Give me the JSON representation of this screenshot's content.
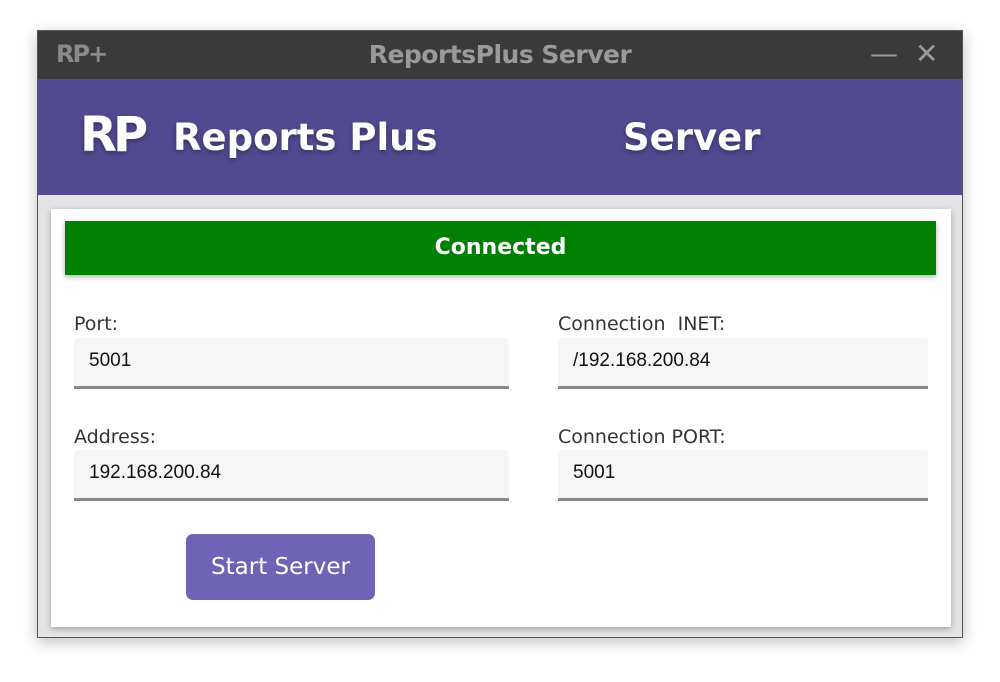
{
  "titlebar": {
    "logo": "RP+",
    "title": "ReportsPlus Server",
    "minimize": "—",
    "close": "✕"
  },
  "header": {
    "logo": "RP",
    "name": "Reports Plus",
    "subtitle": "Server"
  },
  "status": {
    "text": "Connected",
    "color": "#008000"
  },
  "fields": {
    "port": {
      "label": "Port:",
      "value": "5001"
    },
    "address": {
      "label": "Address:",
      "value": "192.168.200.84"
    },
    "conn_inet": {
      "label": "Connection  INET:",
      "value": "/192.168.200.84"
    },
    "conn_port": {
      "label": "Connection PORT:",
      "value": "5001"
    }
  },
  "start_button": "Start Server"
}
